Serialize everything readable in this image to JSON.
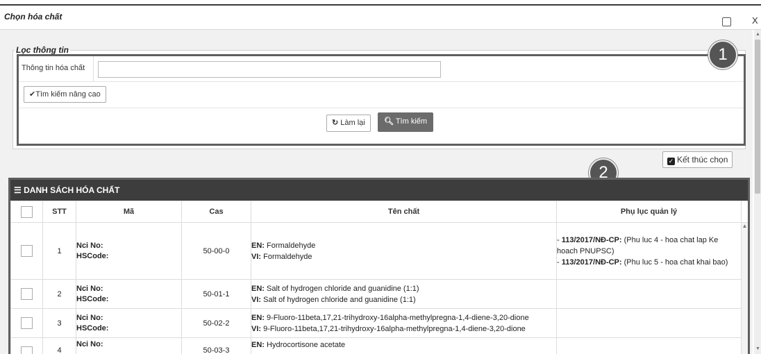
{
  "window": {
    "title": "Chọn hóa chất",
    "close_label": "X"
  },
  "filter": {
    "legend": "Lọc thông tin",
    "info_label": "Thông tin hóa chất",
    "info_value": "",
    "advanced_label": "Tìm kiếm nâng cao",
    "reset_label": "Làm lại",
    "search_label": "Tìm kiếm"
  },
  "badges": {
    "one": "1",
    "two": "2"
  },
  "finish_label": "Kết thúc chọn",
  "list": {
    "title": "DANH SÁCH HÓA CHẤT",
    "columns": {
      "stt": "STT",
      "ma": "Mã",
      "cas": "Cas",
      "ten": "Tên chất",
      "phu": "Phụ lục quản lý"
    },
    "rows": [
      {
        "stt": "1",
        "nci": "Nci No:",
        "hs": "HSCode:",
        "cas": "50-00-0",
        "en_label": "EN:",
        "en": " Formaldehyde",
        "vi_label": "VI:",
        "vi": " Formaldehyde",
        "p1_code": "113/2017/NĐ-CP:",
        "p1_text": " (Phu luc 4 - hoa chat lap Ke hoach PNUPSC)",
        "p2_code": "113/2017/NĐ-CP:",
        "p2_text": " (Phu luc 5 - hoa chat khai bao)"
      },
      {
        "stt": "2",
        "nci": "Nci No:",
        "hs": "HSCode:",
        "cas": "50-01-1",
        "en_label": "EN:",
        "en": " Salt of hydrogen chloride and guanidine (1:1)",
        "vi_label": "VI:",
        "vi": " Salt of hydrogen chloride and guanidine (1:1)"
      },
      {
        "stt": "3",
        "nci": "Nci No:",
        "hs": "HSCode:",
        "cas": "50-02-2",
        "en_label": "EN:",
        "en": " 9-Fluoro-11beta,17,21-trihydroxy-16alpha-methylpregna-1,4-diene-3,20-dione",
        "vi_label": "VI:",
        "vi": " 9-Fluoro-11beta,17,21-trihydroxy-16alpha-methylpregna-1,4-diene-3,20-dione"
      },
      {
        "stt": "4",
        "nci": "Nci No:",
        "cas": "50-03-3",
        "en_label": "EN:",
        "en": " Hydrocortisone acetate"
      }
    ]
  }
}
